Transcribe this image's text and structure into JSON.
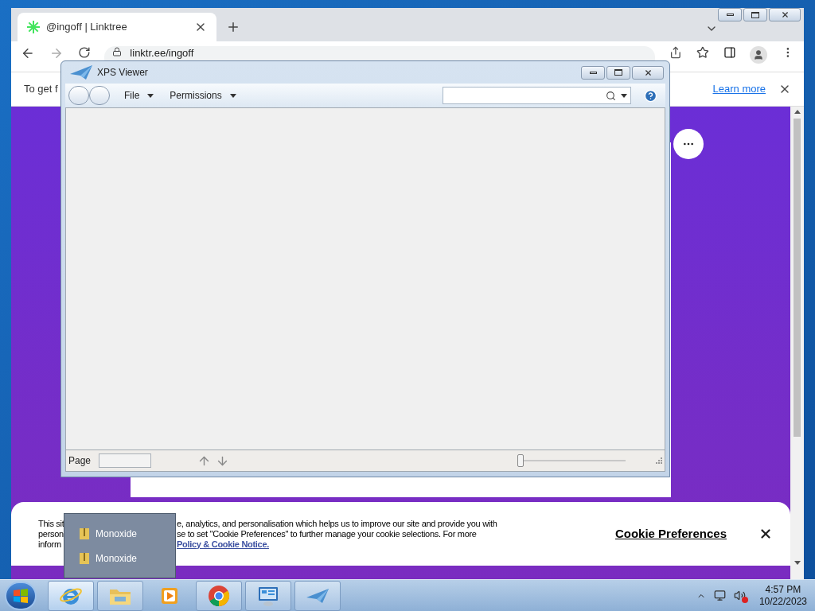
{
  "browser": {
    "tab": {
      "title": "@ingoff | Linktree",
      "selected": true
    },
    "address": "linktr.ee/ingoff",
    "info_bar": {
      "text": "To get f",
      "link": "Learn more"
    },
    "cookie_banner": {
      "lines": [
        {
          "left": "This sit",
          "right": "e, analytics, and personalisation which helps us to improve our site and provide you with"
        },
        {
          "left": "person",
          "right": "se to set \"Cookie Preferences\" to further manage your cookie selections. For more"
        },
        {
          "left": "inform",
          "link": "Policy & Cookie Notice."
        }
      ],
      "preferences": "Cookie Preferences"
    }
  },
  "xps_viewer": {
    "title": "XPS Viewer",
    "menus": [
      "File",
      "Permissions"
    ],
    "page_label": "Page",
    "zoom": {
      "level": 0
    }
  },
  "jump_list": {
    "items": [
      "Monoxide",
      "Monoxide"
    ]
  },
  "taskbar": {
    "apps": [
      {
        "kind": "ie",
        "running": true,
        "selected": true
      },
      {
        "kind": "explorer",
        "running": true,
        "selected": false
      },
      {
        "kind": "media",
        "running": false,
        "selected": false
      },
      {
        "kind": "chrome",
        "running": true,
        "selected": false
      },
      {
        "kind": "control",
        "running": true,
        "selected": false
      },
      {
        "kind": "xps",
        "running": true,
        "selected": false
      }
    ],
    "time": "4:57 PM",
    "date": "10/22/2023"
  }
}
